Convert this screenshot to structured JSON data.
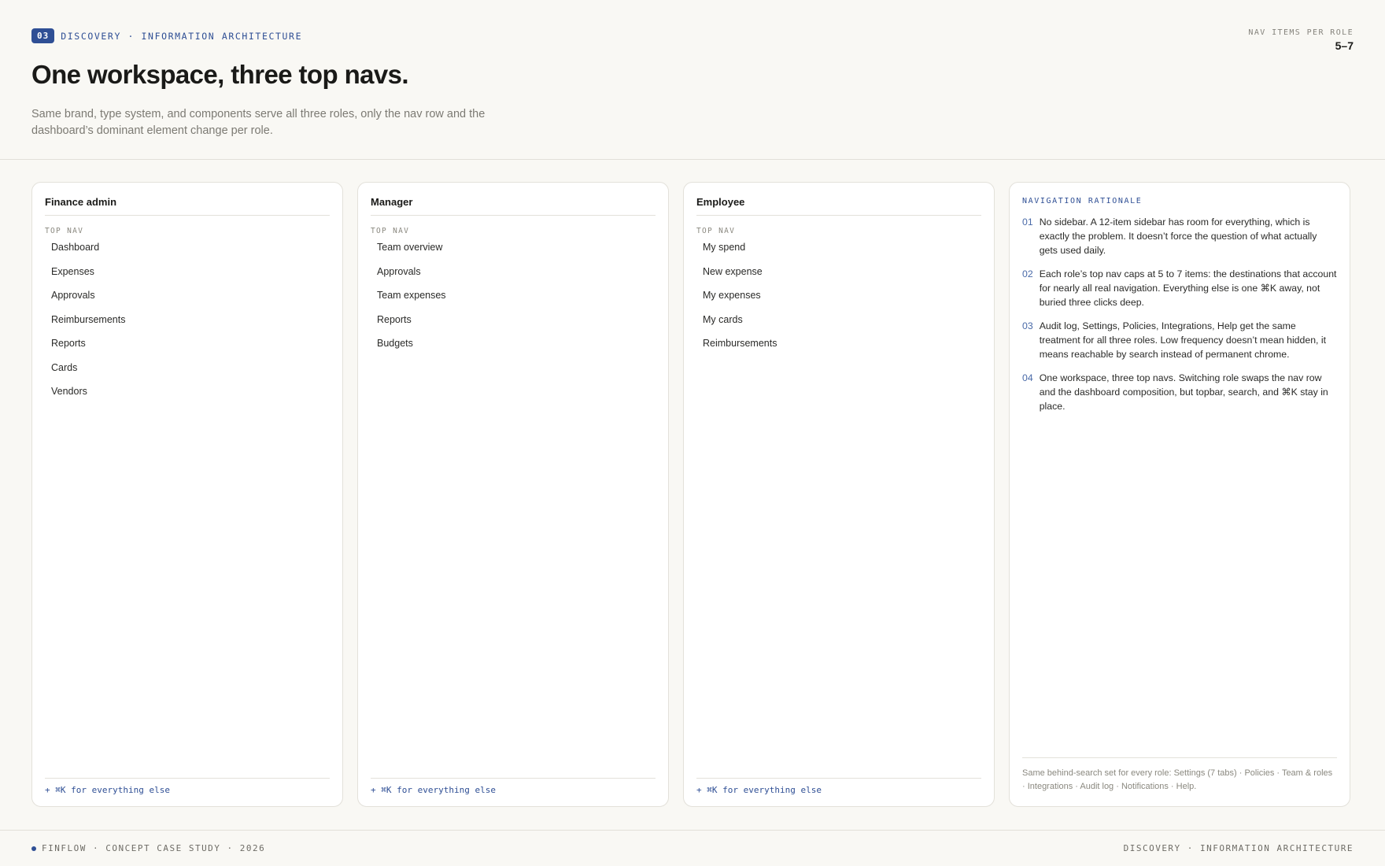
{
  "header": {
    "badge": "03",
    "eyebrow": "DISCOVERY · INFORMATION ARCHITECTURE",
    "title": "One workspace, three top navs.",
    "subtitle": "Same brand, type system, and components serve all three roles, only the nav row and the dashboard’s dominant element change per role.",
    "metric_label": "NAV ITEMS PER ROLE",
    "metric_value": "5–7"
  },
  "roles": [
    {
      "title": "Finance admin",
      "section_label": "TOP NAV",
      "items": [
        "Dashboard",
        "Expenses",
        "Approvals",
        "Reimbursements",
        "Reports",
        "Cards",
        "Vendors"
      ],
      "footer": "+ ⌘K for everything else"
    },
    {
      "title": "Manager",
      "section_label": "TOP NAV",
      "items": [
        "Team overview",
        "Approvals",
        "Team expenses",
        "Reports",
        "Budgets"
      ],
      "footer": "+ ⌘K for everything else"
    },
    {
      "title": "Employee",
      "section_label": "TOP NAV",
      "items": [
        "My spend",
        "New expense",
        "My expenses",
        "My cards",
        "Reimbursements"
      ],
      "footer": "+ ⌘K for everything else"
    }
  ],
  "rationale": {
    "label": "NAVIGATION RATIONALE",
    "items": [
      {
        "num": "01",
        "text": "No sidebar. A 12-item sidebar has room for everything, which is exactly the problem. It doesn’t force the question of what actually gets used daily."
      },
      {
        "num": "02",
        "text": "Each role’s top nav caps at 5 to 7 items: the destinations that account for nearly all real navigation. Everything else is one ⌘K away, not buried three clicks deep."
      },
      {
        "num": "03",
        "text": "Audit log, Settings, Policies, Integrations, Help get the same treatment for all three roles. Low frequency doesn’t mean hidden, it means reachable by search instead of permanent chrome."
      },
      {
        "num": "04",
        "text": "One workspace, three top navs. Switching role swaps the nav row and the dashboard composition, but topbar, search, and ⌘K stay in place."
      }
    ],
    "footer": "Same behind-search set for every role: Settings (7 tabs) · Policies · Team & roles · Integrations · Audit log · Notifications · Help."
  },
  "footer": {
    "left": "FINFLOW · CONCEPT CASE STUDY · 2026",
    "right": "DISCOVERY · INFORMATION ARCHITECTURE"
  },
  "colors": {
    "accent": "#2f4f95",
    "background": "#f9f8f4",
    "card": "#ffffff",
    "border": "#e3e1da"
  }
}
